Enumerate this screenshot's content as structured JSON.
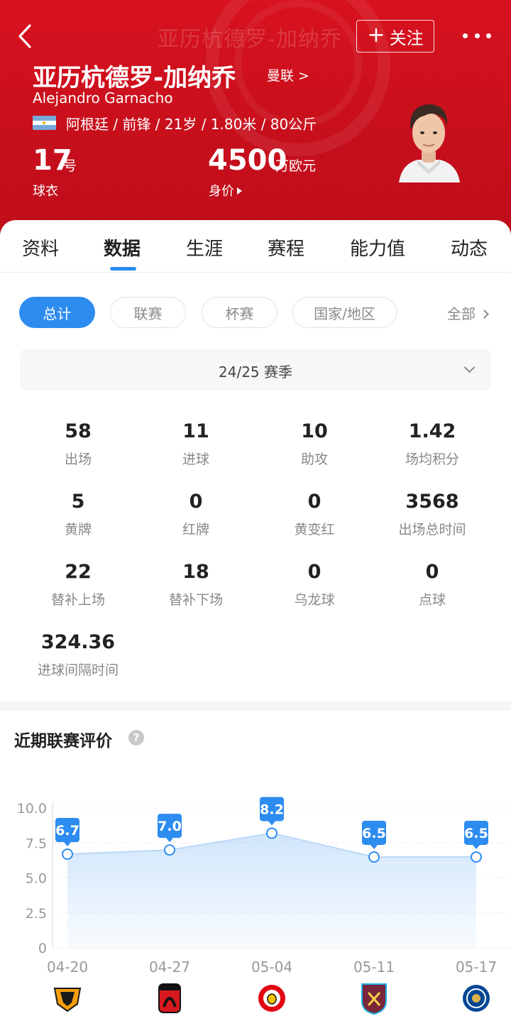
{
  "header": {
    "ghost_title": "亚历杭德罗-加纳乔",
    "follow_label": "关注",
    "name_cn": "亚历杭德罗-加纳乔",
    "team_link": "曼联 >",
    "name_en": "Alejandro Garnacho",
    "info_line": "阿根廷 / 前锋 / 21岁 / 1.80米 / 80公斤",
    "shirt_number": "17",
    "shirt_unit": "号",
    "shirt_label": "球衣",
    "value": "4500",
    "value_unit": "万欧元",
    "value_label": "身价"
  },
  "tabs": [
    "资料",
    "数据",
    "生涯",
    "赛程",
    "能力值",
    "动态"
  ],
  "active_tab": "数据",
  "filters": [
    "总计",
    "联赛",
    "杯赛",
    "国家/地区"
  ],
  "filter_all": "全部",
  "season": "24/25 赛季",
  "stats": [
    {
      "value": "58",
      "label": "出场"
    },
    {
      "value": "11",
      "label": "进球"
    },
    {
      "value": "10",
      "label": "助攻"
    },
    {
      "value": "1.42",
      "label": "场均积分"
    },
    {
      "value": "5",
      "label": "黄牌"
    },
    {
      "value": "0",
      "label": "红牌"
    },
    {
      "value": "0",
      "label": "黄变红"
    },
    {
      "value": "3568",
      "label": "出场总时间"
    },
    {
      "value": "22",
      "label": "替补上场"
    },
    {
      "value": "18",
      "label": "替补下场"
    },
    {
      "value": "0",
      "label": "乌龙球"
    },
    {
      "value": "0",
      "label": "点球"
    },
    {
      "value": "324.36",
      "label": "进球间隔时间"
    }
  ],
  "rating_section": {
    "title": "近期联赛评价",
    "help_icon": "?"
  },
  "colors": {
    "header_red": "#d8121f",
    "accent_blue": "#2d8cf0",
    "wolves": "#f59e0b",
    "bournemouth": "#d71920",
    "brentford": "#e30613",
    "westham": "#7a263a",
    "chelsea": "#034694"
  },
  "chart_data": {
    "type": "line",
    "x": [
      "04-20",
      "04-27",
      "05-04",
      "05-11",
      "05-17"
    ],
    "values": [
      6.7,
      7.0,
      8.2,
      6.5,
      6.5
    ],
    "data_labels": [
      "6.7",
      "7.0",
      "8.2",
      "6.5",
      "6.5"
    ],
    "y_ticks": [
      "0",
      "2.5",
      "5.0",
      "7.5",
      "10.0"
    ],
    "ylim": [
      0,
      10
    ],
    "grid": true,
    "opponents": [
      "wolves-crest-icon",
      "bournemouth-crest-icon",
      "brentford-crest-icon",
      "westham-crest-icon",
      "chelsea-crest-icon"
    ]
  }
}
